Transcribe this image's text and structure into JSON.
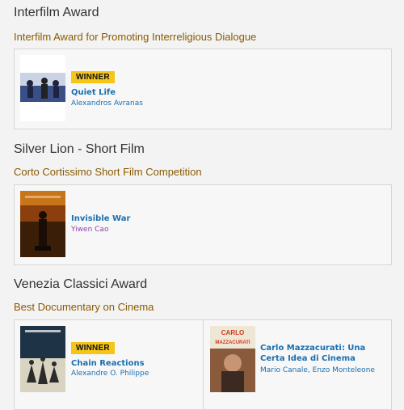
{
  "sections": [
    {
      "title": "Interfilm Award",
      "category": "Interfilm Award for Promoting Interreligious Dialogue",
      "entries": [
        {
          "badge": "WINNER",
          "film": "Quiet Life",
          "people": "Alexandros Avranas"
        }
      ]
    },
    {
      "title": "Silver Lion - Short Film",
      "category": "Corto Cortissimo Short Film Competition",
      "entries": [
        {
          "badge": "",
          "film": "Invisible War",
          "people": "Yiwen Cao"
        }
      ]
    },
    {
      "title": "Venezia Classici Award",
      "category": "Best Documentary on Cinema",
      "entries": [
        {
          "badge": "WINNER",
          "film": "Chain Reactions",
          "people": "Alexandre O. Philippe"
        },
        {
          "badge": "",
          "film": "Carlo Mazzacurati: Una Certa Idea di Cinema",
          "people": "Mario Canale, Enzo Monteleone"
        }
      ]
    }
  ],
  "poster_text": {
    "carlo": "CARLO MAZZACURATI"
  },
  "colors": {
    "accent_gold": "#f5c518",
    "link_blue": "#1a6fb0",
    "category_brown": "#8a5a00",
    "person_purple": "#8e44ad"
  }
}
